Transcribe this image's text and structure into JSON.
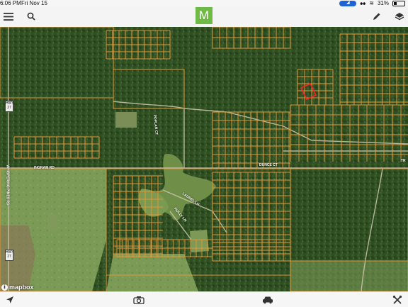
{
  "status_bar": {
    "time": "6:06 PM",
    "date": "Fri Nov 15",
    "battery": "31%"
  },
  "toolbar": {
    "logo_letter": "M",
    "menu_icon": "hamburger-menu-icon",
    "search_icon": "search-icon",
    "edit_icon": "pencil-icon",
    "layers_icon": "layers-icon"
  },
  "map": {
    "roads": {
      "highway_shield_top": "HWY 27",
      "highway_shield_bottom": "HWY 27",
      "vertical_road": "WHISPERING PINES RD",
      "ingram_rd": "INGRAM RD",
      "poplar_ct": "POPLAR CT",
      "dunce_ct": "DUNCE CT",
      "laurel_ln": "LAUREL LN",
      "holly_ln": "HOLLY LN",
      "edge_label": "TR"
    },
    "attribution": "mapbox",
    "colors": {
      "parcel_lines": "#e0963a",
      "selected_parcel": "#ff2222",
      "forest": "#2f4f22",
      "field": "#7a9a55"
    }
  },
  "bottom_bar": {
    "location_icon": "location-arrow-icon",
    "camera_icon": "camera-icon",
    "car_icon": "car-icon",
    "tools_icon": "tools-icon"
  }
}
